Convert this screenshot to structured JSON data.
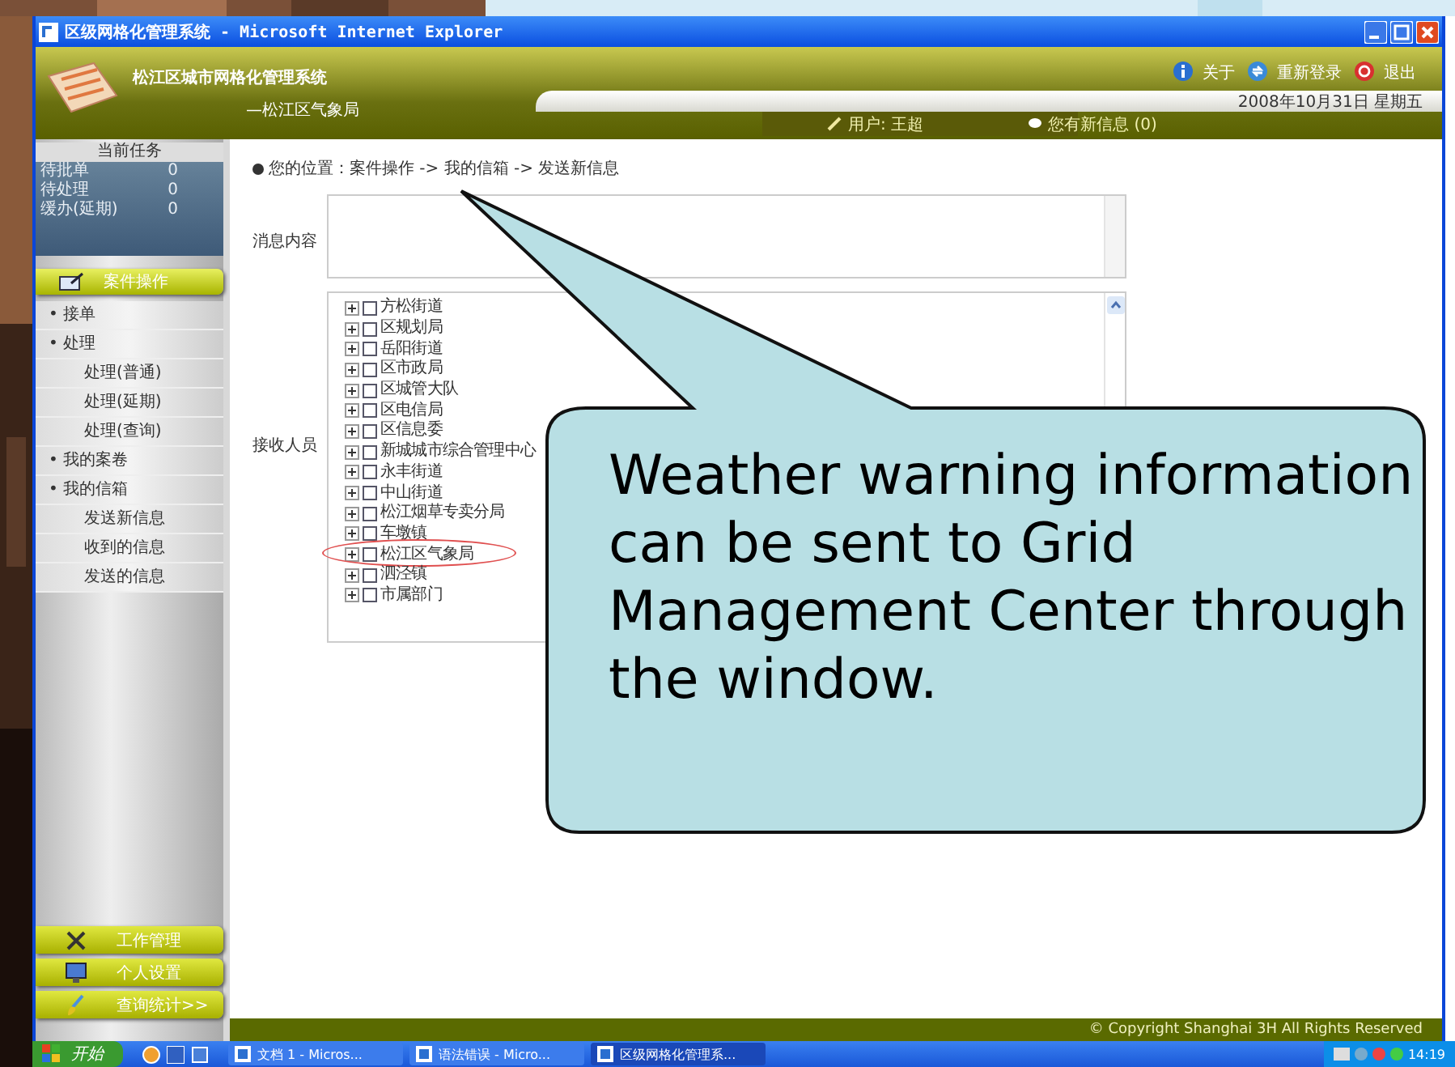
{
  "window": {
    "title": "区级网格化管理系统 - Microsoft Internet Explorer"
  },
  "header": {
    "system_name": "松江区城市网格化管理系统",
    "department": "—松江区气象局",
    "links": [
      {
        "label": "关于"
      },
      {
        "label": "重新登录"
      },
      {
        "label": "退出"
      }
    ],
    "date": "2008年10月31日 星期五",
    "user": "用户: 王超",
    "messages": "您有新信息 (0)"
  },
  "sidebar": {
    "tasks_title": "当前任务",
    "tasks": [
      {
        "label": "待批单",
        "count": "0"
      },
      {
        "label": "待处理",
        "count": "0"
      },
      {
        "label": "缓办(延期)",
        "count": "0"
      }
    ],
    "section": "案件操作",
    "menu": [
      {
        "label": "• 接单"
      },
      {
        "label": "• 处理",
        "children": [
          {
            "label": "处理(普通)"
          },
          {
            "label": "处理(延期)"
          },
          {
            "label": "处理(查询)"
          }
        ]
      },
      {
        "label": "• 我的案卷"
      },
      {
        "label": "• 我的信箱",
        "children": [
          {
            "label": "发送新信息"
          },
          {
            "label": "收到的信息"
          },
          {
            "label": "发送的信息"
          }
        ]
      }
    ],
    "bottom_buttons": [
      {
        "label": "工作管理"
      },
      {
        "label": "个人设置"
      },
      {
        "label": "查询统计>>"
      }
    ]
  },
  "content": {
    "breadcrumb": "您的位置：案件操作 -> 我的信箱 -> 发送新信息",
    "message_label": "消息内容",
    "recipients_label": "接收人员",
    "recipients": [
      {
        "label": "方松街道",
        "checked": false,
        "highlighted": false
      },
      {
        "label": "区规划局",
        "checked": false,
        "highlighted": false
      },
      {
        "label": "岳阳街道",
        "checked": false,
        "highlighted": false
      },
      {
        "label": "区市政局",
        "checked": false,
        "highlighted": false
      },
      {
        "label": "区城管大队",
        "checked": false,
        "highlighted": false
      },
      {
        "label": "区电信局",
        "checked": false,
        "highlighted": false
      },
      {
        "label": "区信息委",
        "checked": false,
        "highlighted": false
      },
      {
        "label": "新城城市综合管理中心",
        "checked": false,
        "highlighted": false
      },
      {
        "label": "永丰街道",
        "checked": false,
        "highlighted": false
      },
      {
        "label": "中山街道",
        "checked": false,
        "highlighted": false
      },
      {
        "label": "松江烟草专卖分局",
        "checked": false,
        "highlighted": false
      },
      {
        "label": "车墩镇",
        "checked": false,
        "highlighted": false
      },
      {
        "label": "松江区气象局",
        "checked": false,
        "highlighted": true
      },
      {
        "label": "泗泾镇",
        "checked": false,
        "highlighted": false
      },
      {
        "label": "市属部门",
        "checked": false,
        "highlighted": false
      }
    ]
  },
  "footer": {
    "copyright": "© Copyright Shanghai 3H All Rights Reserved"
  },
  "taskbar": {
    "start": "开始",
    "tasks": [
      {
        "label": "文档 1 - Micros...",
        "selected": false
      },
      {
        "label": "语法错误 - Micro...",
        "selected": false
      },
      {
        "label": "区级网格化管理系...",
        "selected": true
      }
    ],
    "clock": "14:19"
  },
  "callout": {
    "text": "Weather warning information can be sent to Grid Management Center through the window."
  }
}
